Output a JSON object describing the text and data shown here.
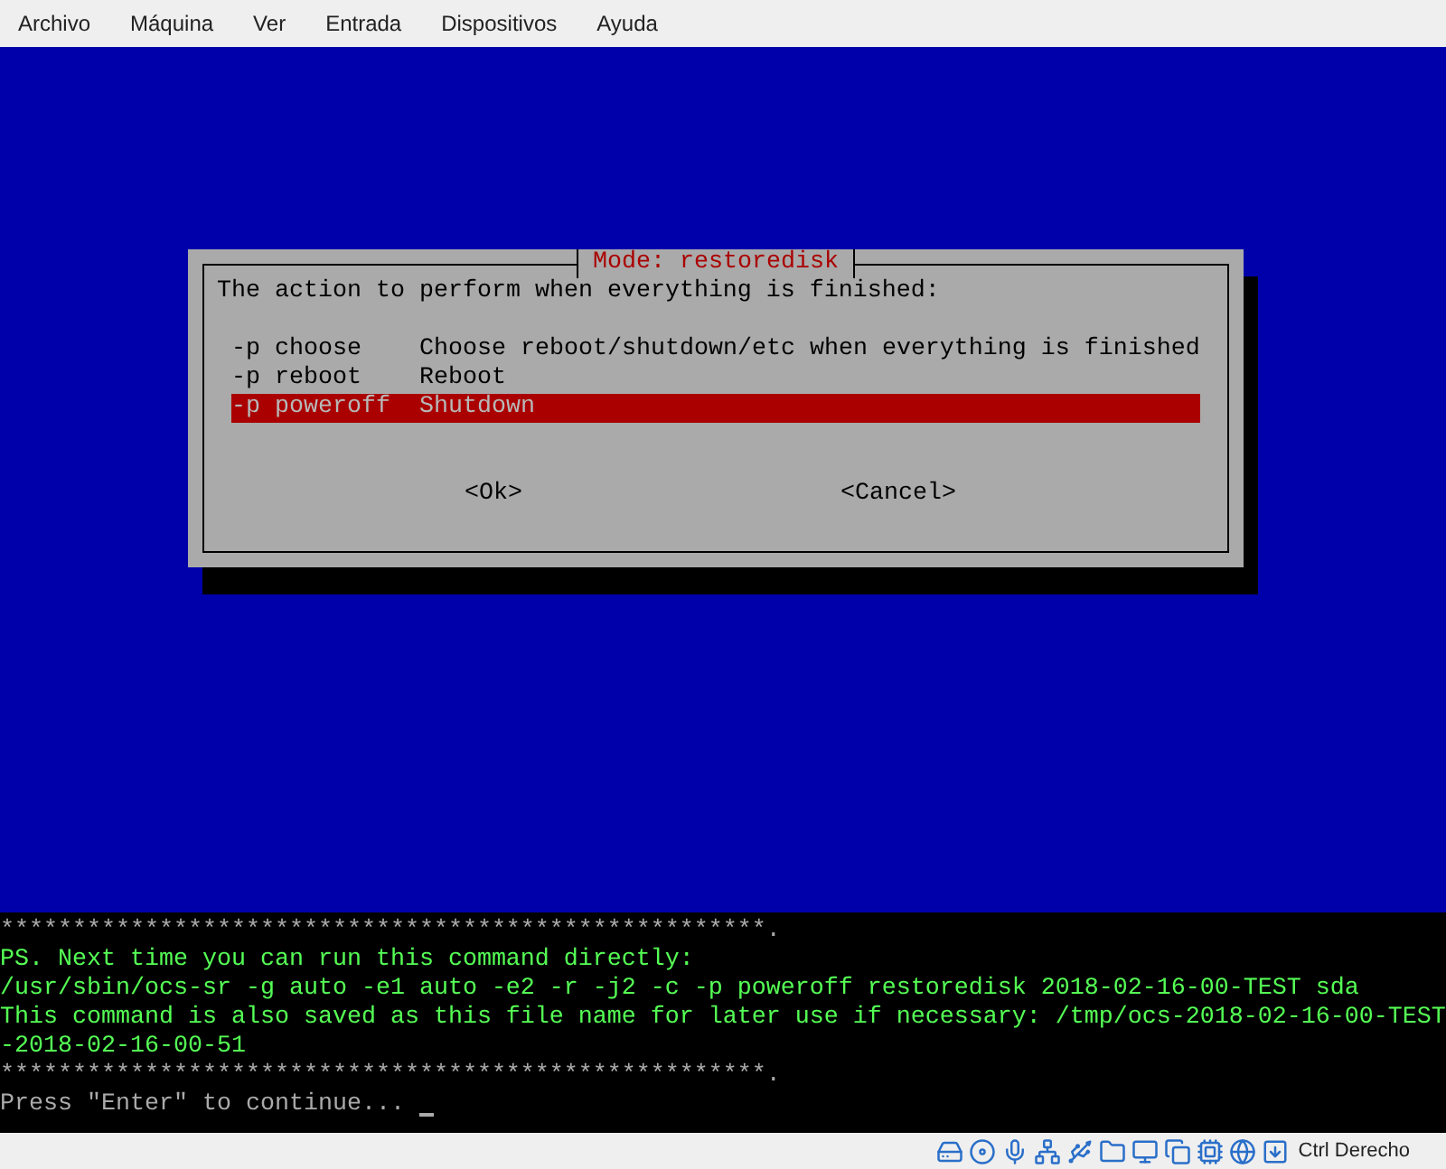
{
  "menu": [
    "Archivo",
    "Máquina",
    "Ver",
    "Entrada",
    "Dispositivos",
    "Ayuda"
  ],
  "dialog": {
    "title": "Mode: restoredisk",
    "prompt": "The action to perform when everything is finished:",
    "options": [
      {
        "tag": "-p choose",
        "label": "Choose reboot/shutdown/etc when everything is finished",
        "selected": false
      },
      {
        "tag": "-p reboot",
        "label": "Reboot",
        "selected": false
      },
      {
        "tag": "-p poweroff",
        "label": "Shutdown",
        "selected": true
      }
    ],
    "buttons": [
      "<Ok>",
      "<Cancel>"
    ]
  },
  "terminal": [
    {
      "kind": "rule",
      "text": "*****************************************************."
    },
    {
      "kind": "info",
      "text": "PS. Next time you can run this command directly:"
    },
    {
      "kind": "info",
      "text": "/usr/sbin/ocs-sr -g auto -e1 auto -e2 -r -j2 -c -p poweroff restoredisk 2018-02-16-00-TEST sda"
    },
    {
      "kind": "info",
      "text": "This command is also saved as this file name for later use if necessary: /tmp/ocs-2018-02-16-00-TEST"
    },
    {
      "kind": "info",
      "text": "-2018-02-16-00-51"
    },
    {
      "kind": "rule",
      "text": "*****************************************************."
    },
    {
      "kind": "prompt",
      "text": "Press \"Enter\" to continue..."
    }
  ],
  "status_bar": {
    "host_key": "Ctrl Derecho"
  }
}
